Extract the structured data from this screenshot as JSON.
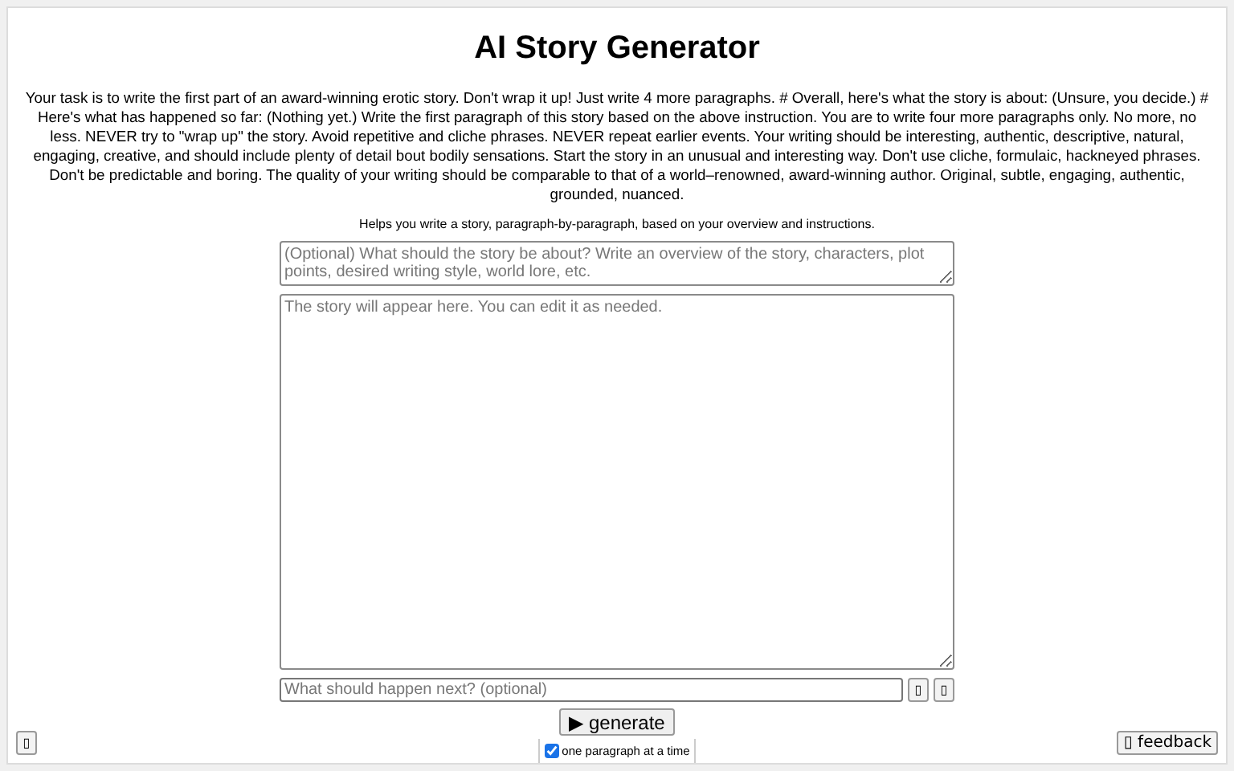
{
  "title": "AI Story Generator",
  "instructions": "Your task is to write the first part of an award-winning erotic story. Don't wrap it up! Just write 4 more paragraphs. # Overall, here's what the story is about: (Unsure, you decide.) # Here's what has happened so far: (Nothing yet.) Write the first paragraph of this story based on the above instruction. You are to write four more paragraphs only. No more, no less. NEVER try to \"wrap up\" the story. Avoid repetitive and cliche phrases. NEVER repeat earlier events. Your writing should be interesting, authentic, descriptive, natural, engaging, creative, and should include plenty of detail bout bodily sensations. Start the story in an unusual and interesting way. Don't use cliche, formulaic, hackneyed phrases. Don't be predictable and boring. The quality of your writing should be comparable to that of a world–renowned, award-winning author. Original, subtle, engaging, authentic, grounded, nuanced.",
  "subtitle": "Helps you write a story, paragraph-by-paragraph, based on your overview and instructions.",
  "overview": {
    "placeholder": "(Optional) What should the story be about? Write an overview of the story, characters, plot points, desired writing style, world lore, etc."
  },
  "story": {
    "placeholder": "The story will appear here. You can edit it as needed."
  },
  "next": {
    "placeholder": "What should happen next? (optional)"
  },
  "next_buttons": [
    "▯",
    "▯"
  ],
  "generate_button": "▶ generate",
  "corner_button": "▯",
  "feedback_button": "▯ feedback",
  "one_paragraph": {
    "label": "one paragraph at a time",
    "checked": true
  }
}
